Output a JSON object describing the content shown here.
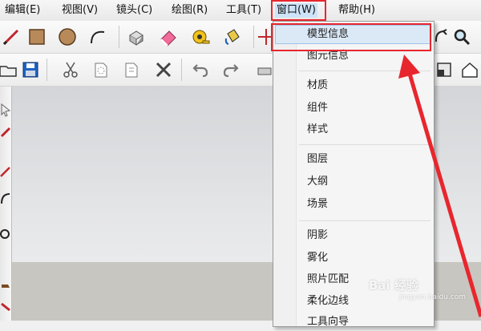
{
  "menubar": {
    "items": [
      {
        "label": "编辑(E)"
      },
      {
        "label": "视图(V)"
      },
      {
        "label": "镜头(C)"
      },
      {
        "label": "绘图(R)"
      },
      {
        "label": "工具(T)"
      },
      {
        "label": "窗口(W)"
      },
      {
        "label": "帮助(H)"
      }
    ],
    "active_index": 5
  },
  "window_menu": {
    "items": [
      {
        "label": "模型信息",
        "highlighted": true
      },
      {
        "label": "图元信息"
      },
      {
        "label": "材质"
      },
      {
        "label": "组件"
      },
      {
        "label": "样式"
      },
      {
        "label": "图层"
      },
      {
        "label": "大纲"
      },
      {
        "label": "场景"
      },
      {
        "label": "阴影"
      },
      {
        "label": "雾化"
      },
      {
        "label": "照片匹配"
      },
      {
        "label": "柔化边线"
      },
      {
        "label": "工具向导"
      }
    ]
  },
  "toolbar_top": {
    "icons": [
      "pencil-icon",
      "rectangle-icon",
      "circle-icon",
      "arc-icon",
      "push-pull-icon",
      "eraser-icon",
      "tape-measure-icon",
      "paint-bucket-icon",
      "move-icon",
      "orbit-icon",
      "search-icon"
    ]
  },
  "toolbar_second": {
    "icons": [
      "open-folder-icon",
      "save-icon",
      "cut-icon",
      "copy-icon",
      "paste-icon",
      "delete-icon",
      "undo-icon",
      "redo-icon",
      "print-icon",
      "house-icon"
    ]
  },
  "watermark": {
    "text": "Bai 经验",
    "sub": "jingyan.baidu.com"
  },
  "colors": {
    "highlight_red": "#e8262d",
    "menu_hover": "#dbe9f7",
    "canvas_sky": "#dfe0e2",
    "ground": "#c8c6c1"
  }
}
